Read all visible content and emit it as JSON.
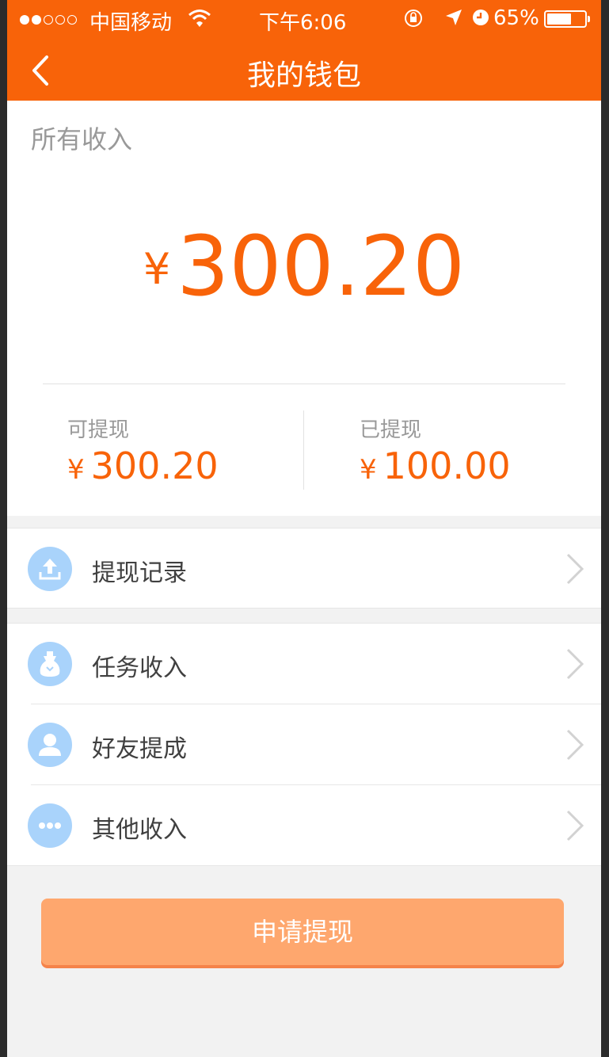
{
  "status_bar": {
    "carrier": "中国移动",
    "time": "下午6:06",
    "battery": "65%",
    "battery_level": 0.65,
    "icons": [
      "signal-dots-icon",
      "wifi-icon",
      "lock-rotation-icon",
      "location-arrow-icon",
      "alarm-icon",
      "battery-icon"
    ]
  },
  "nav": {
    "title": "我的钱包",
    "back_icon": "chevron-left-icon"
  },
  "total": {
    "label": "所有收入",
    "currency": "¥",
    "amount": "300.20"
  },
  "withdrawable": {
    "label": "可提现",
    "currency": "¥",
    "amount": "300.20"
  },
  "withdrawn": {
    "label": "已提现",
    "currency": "¥",
    "amount": "100.00"
  },
  "menu": {
    "records": {
      "label": "提现记录",
      "icon": "upload-icon"
    },
    "items": [
      {
        "label": "任务收入",
        "icon": "money-bag-icon"
      },
      {
        "label": "好友提成",
        "icon": "person-icon"
      },
      {
        "label": "其他收入",
        "icon": "more-dots-icon"
      }
    ]
  },
  "apply_button": {
    "label": "申请提现"
  },
  "colors": {
    "accent": "#f86309",
    "muted_text": "#999999",
    "body_text": "#404040",
    "icon_bg": "#a9d3fb",
    "button_bg": "#fea76e",
    "background": "#f2f2f2"
  }
}
